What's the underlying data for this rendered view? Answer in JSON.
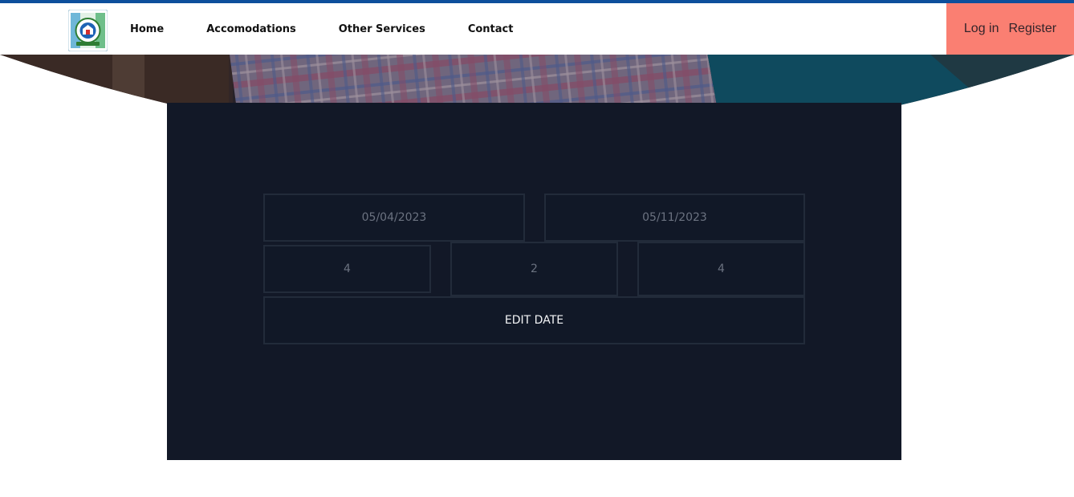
{
  "nav": {
    "links": [
      "Home",
      "Accomodations",
      "Other Services",
      "Contact"
    ],
    "login_label": "Log in",
    "register_label": "Register"
  },
  "booking": {
    "check_in": "05/04/2023",
    "check_out": "05/11/2023",
    "field_a": "4",
    "field_b": "2",
    "field_c": "4",
    "edit_label": "EDIT DATE"
  },
  "colors": {
    "top_strip": "#0d4f9c",
    "auth_bg": "#fa7f72",
    "panel_bg": "#121827",
    "field_border": "#222b3a"
  },
  "icons": {
    "logo": "school-crest-logo-icon"
  }
}
